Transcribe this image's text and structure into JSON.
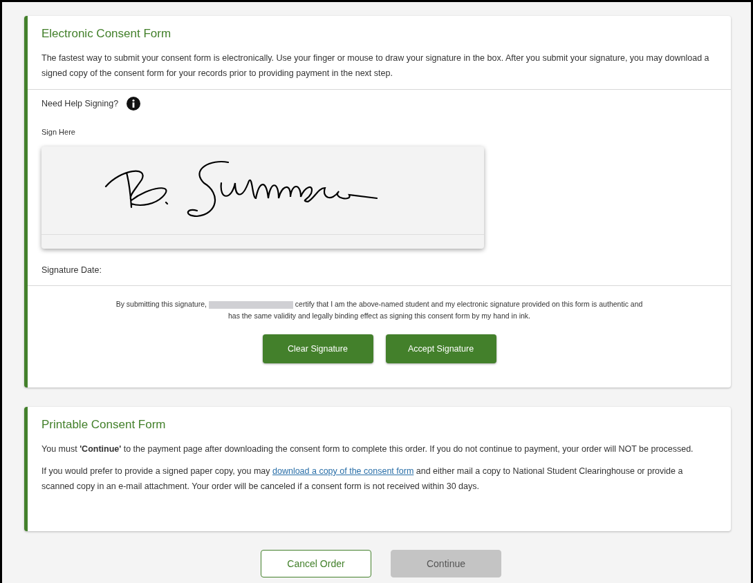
{
  "electronic_form": {
    "title": "Electronic Consent Form",
    "intro": "The fastest way to submit your consent form is electronically. Use your finger or mouse to draw your signature in the box. After you submit your signature, you may download a signed copy of the consent form for your records prior to providing payment in the next step.",
    "help_label": "Need Help Signing?",
    "sign_label": "Sign Here",
    "date_label": "Signature Date:",
    "certify_before": "By submitting this signature,",
    "certify_after": "certify that I am the above-named student and my electronic signature provided on this form is authentic and has the same validity and legally binding effect as signing this consent form by my hand in ink.",
    "buttons": [
      "Clear Signature",
      "Accept Signature"
    ]
  },
  "printable_form": {
    "title": "Printable Consent Form",
    "notice": "You must **'Continue'** to the payment page after downloading the consent form to complete this order. If you do not continue to payment, your order will NOT be processed.",
    "paper_before": "If you would prefer to provide a signed paper copy, you may",
    "paper_link": "download a copy of the consent form",
    "paper_after": "and either mail a copy to National Student Clearinghouse or provide a scanned copy in an e-mail attachment. Your order will be canceled if a consent form is not received within 30 days."
  },
  "footer_buttons": [
    {
      "label": "Cancel Order",
      "kind": "outline",
      "disabled": false
    },
    {
      "label": "Continue",
      "kind": "solid",
      "disabled": true
    }
  ]
}
